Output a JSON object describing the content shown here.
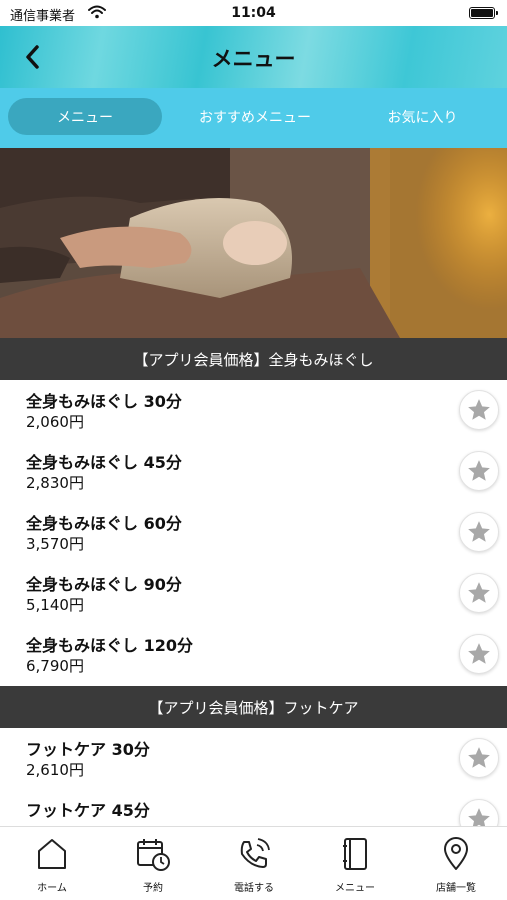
{
  "status_bar": {
    "carrier": "通信事業者",
    "time": "11:04"
  },
  "header": {
    "title": "メニュー"
  },
  "tabs": [
    {
      "label": "メニュー",
      "active": true
    },
    {
      "label": "おすすめメニュー",
      "active": false
    },
    {
      "label": "お気に入り",
      "active": false
    }
  ],
  "sections": [
    {
      "title": "【アプリ会員価格】全身もみほぐし",
      "items": [
        {
          "name": "全身もみほぐし 30分",
          "price": "2,060円"
        },
        {
          "name": "全身もみほぐし 45分",
          "price": "2,830円"
        },
        {
          "name": "全身もみほぐし 60分",
          "price": "3,570円"
        },
        {
          "name": "全身もみほぐし 90分",
          "price": "5,140円"
        },
        {
          "name": "全身もみほぐし 120分",
          "price": "6,790円"
        }
      ]
    },
    {
      "title": "【アプリ会員価格】フットケア",
      "items": [
        {
          "name": "フットケア 30分",
          "price": "2,610円"
        },
        {
          "name": "フットケア 45分",
          "price": ""
        }
      ]
    }
  ],
  "bottom_nav": [
    {
      "label": "ホーム",
      "icon": "home-icon"
    },
    {
      "label": "予約",
      "icon": "calendar-clock-icon"
    },
    {
      "label": "電話する",
      "icon": "phone-icon"
    },
    {
      "label": "メニュー",
      "icon": "menu-book-icon"
    },
    {
      "label": "店舗一覧",
      "icon": "location-pin-icon"
    }
  ],
  "colors": {
    "tab_bar": "#4fcbe9",
    "tab_active": "#3aa7bf",
    "section_header": "#3a3a3a",
    "favorite_star": "#a8a8a8"
  }
}
